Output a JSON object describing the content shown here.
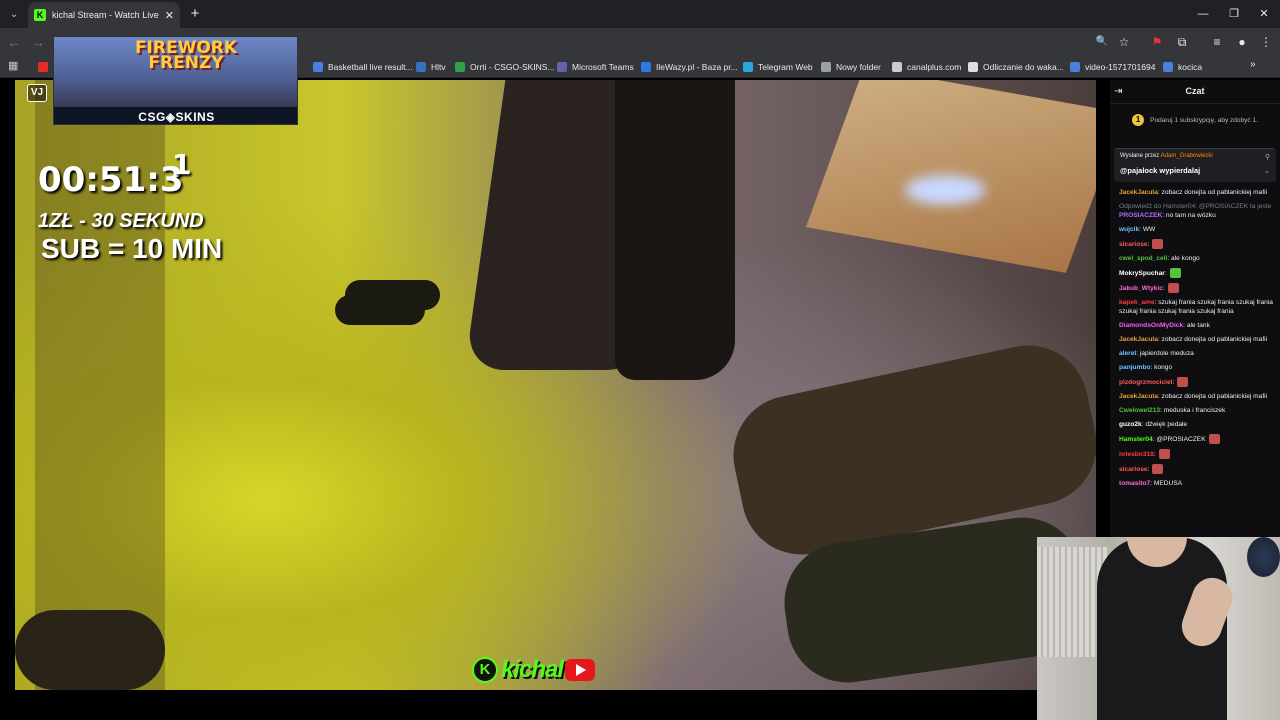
{
  "browser": {
    "tab": {
      "favicon_letter": "K",
      "title": "kichal Stream - Watch Live on Ki",
      "close_glyph": "✕"
    },
    "new_tab_glyph": "+",
    "tab_list_glyph": "⌄",
    "window_controls": {
      "minimize": "—",
      "restore": "❐",
      "close": "✕"
    },
    "nav": {
      "back": "←",
      "forward": "→",
      "reload": "↻"
    },
    "toolbar_icons": {
      "zoom": "🔍",
      "star": "☆",
      "extension": "⧉",
      "menu": "⋮"
    }
  },
  "bookmarks": [
    {
      "label": "Basketball live result...",
      "icon_color": "#4a7fe0"
    },
    {
      "label": "Hltv",
      "icon_color": "#3a6fbf"
    },
    {
      "label": "Orrti - CSGO-SKINS...",
      "icon_color": "#2fa34a"
    },
    {
      "label": "Microsoft Teams",
      "icon_color": "#6264a7"
    },
    {
      "label": "IleWazy.pl - Baza pr...",
      "icon_color": "#2a7ae2"
    },
    {
      "label": "Telegram Web",
      "icon_color": "#2aa3e0"
    },
    {
      "label": "Nowy folder",
      "icon_color": "#9aa0a6"
    },
    {
      "label": "canalplus.com",
      "icon_color": "#cccccc"
    },
    {
      "label": "Odliczanie do waka...",
      "icon_color": "#dddddd"
    },
    {
      "label": "video-1571701694",
      "icon_color": "#4a7fe0"
    },
    {
      "label": "kocica",
      "icon_color": "#4a7fe0"
    }
  ],
  "stream": {
    "banner_title": "FIREWORK FRENZY",
    "banner_brand": "CSG◈SKINS",
    "vj_logo": "VJ",
    "timer": "00:51:3",
    "timer_sup": "1",
    "promo_line1": "1ZŁ - 30 SEKUND",
    "promo_line2": "SUB = 10 MIN",
    "logo_k": "K",
    "logo_text": "kichal"
  },
  "chat": {
    "title": "Czat",
    "gift_icon": "1",
    "gift_text": "Podaruj 1 subskrypcję, aby zdobyć 1.",
    "pinned_label": "Wysłane przez",
    "pinned_user": "Adam_Grabowiecki",
    "pinned_message": "@pajalock wypierdalaj",
    "messages": [
      {
        "user": "JacekJacula",
        "color": "#e6a23c",
        "text": ": zobacz donejta od pablanickiej mafii"
      },
      {
        "reply": "Odpowiedź do Hamster04: @PROSIACZEK ta jeste"
      },
      {
        "user": "PROSIACZEK",
        "color": "#b36cff",
        "text": ": no tam na wózku"
      },
      {
        "user": "wujcik",
        "color": "#6cc3ff",
        "text": ": WW"
      },
      {
        "user": "sicariose",
        "color": "#ff5a5a",
        "text": ":",
        "emote": "#c0504d"
      },
      {
        "user": "cwel_spod_celi",
        "color": "#53c53a",
        "text": ": ale kongo"
      },
      {
        "user": "MokrySpuchar",
        "color": "#ffffff",
        "text": ":",
        "emote": "#53c53a"
      },
      {
        "user": "Jakub_Wtykic",
        "color": "#ff6ad5",
        "text": ":",
        "emote": "#c0504d"
      },
      {
        "user": "kapek_ame",
        "color": "#ff3b3b",
        "text": ": szukaj frania  szukaj frania  szukaj frania  szukaj frania  szukaj frania  szukaj frania"
      },
      {
        "user": "DiamondsOnMyDick",
        "color": "#ff5af0",
        "text": ": ale tank"
      },
      {
        "user": "JacekJacula",
        "color": "#e6a23c",
        "text": ": zobacz donejta od pablanickiej mafii"
      },
      {
        "user": "alerel",
        "color": "#6cc3ff",
        "text": ": japierdole meduza"
      },
      {
        "user": "panjumbo",
        "color": "#6cc3ff",
        "text": ": kongo"
      },
      {
        "user": "pizdogrzmociciel",
        "color": "#ff5a5a",
        "text": ":",
        "emote": "#c0504d"
      },
      {
        "user": "JacekJacula",
        "color": "#e6a23c",
        "text": ": zobacz donejta od pablanickiej mafii"
      },
      {
        "user": "Cwelowel213",
        "color": "#53c53a",
        "text": ": meduska i franciszek"
      },
      {
        "user": "guzo2k",
        "color": "#ffffff",
        "text": ": dźwięk pedałe"
      },
      {
        "user": "Hamster04",
        "color": "#53fc18",
        "text": ": @PROSIACZEK",
        "emote": "#c0504d"
      },
      {
        "user": "nrlesbn318",
        "color": "#ff3b3b",
        "text": ":",
        "emote": "#c0504d"
      },
      {
        "user": "sicariose",
        "color": "#ff5a5a",
        "text": ":",
        "emote": "#c0504d"
      },
      {
        "user": "tomasito7",
        "color": "#ff6ad5",
        "text": ": MEDUSA"
      }
    ]
  }
}
